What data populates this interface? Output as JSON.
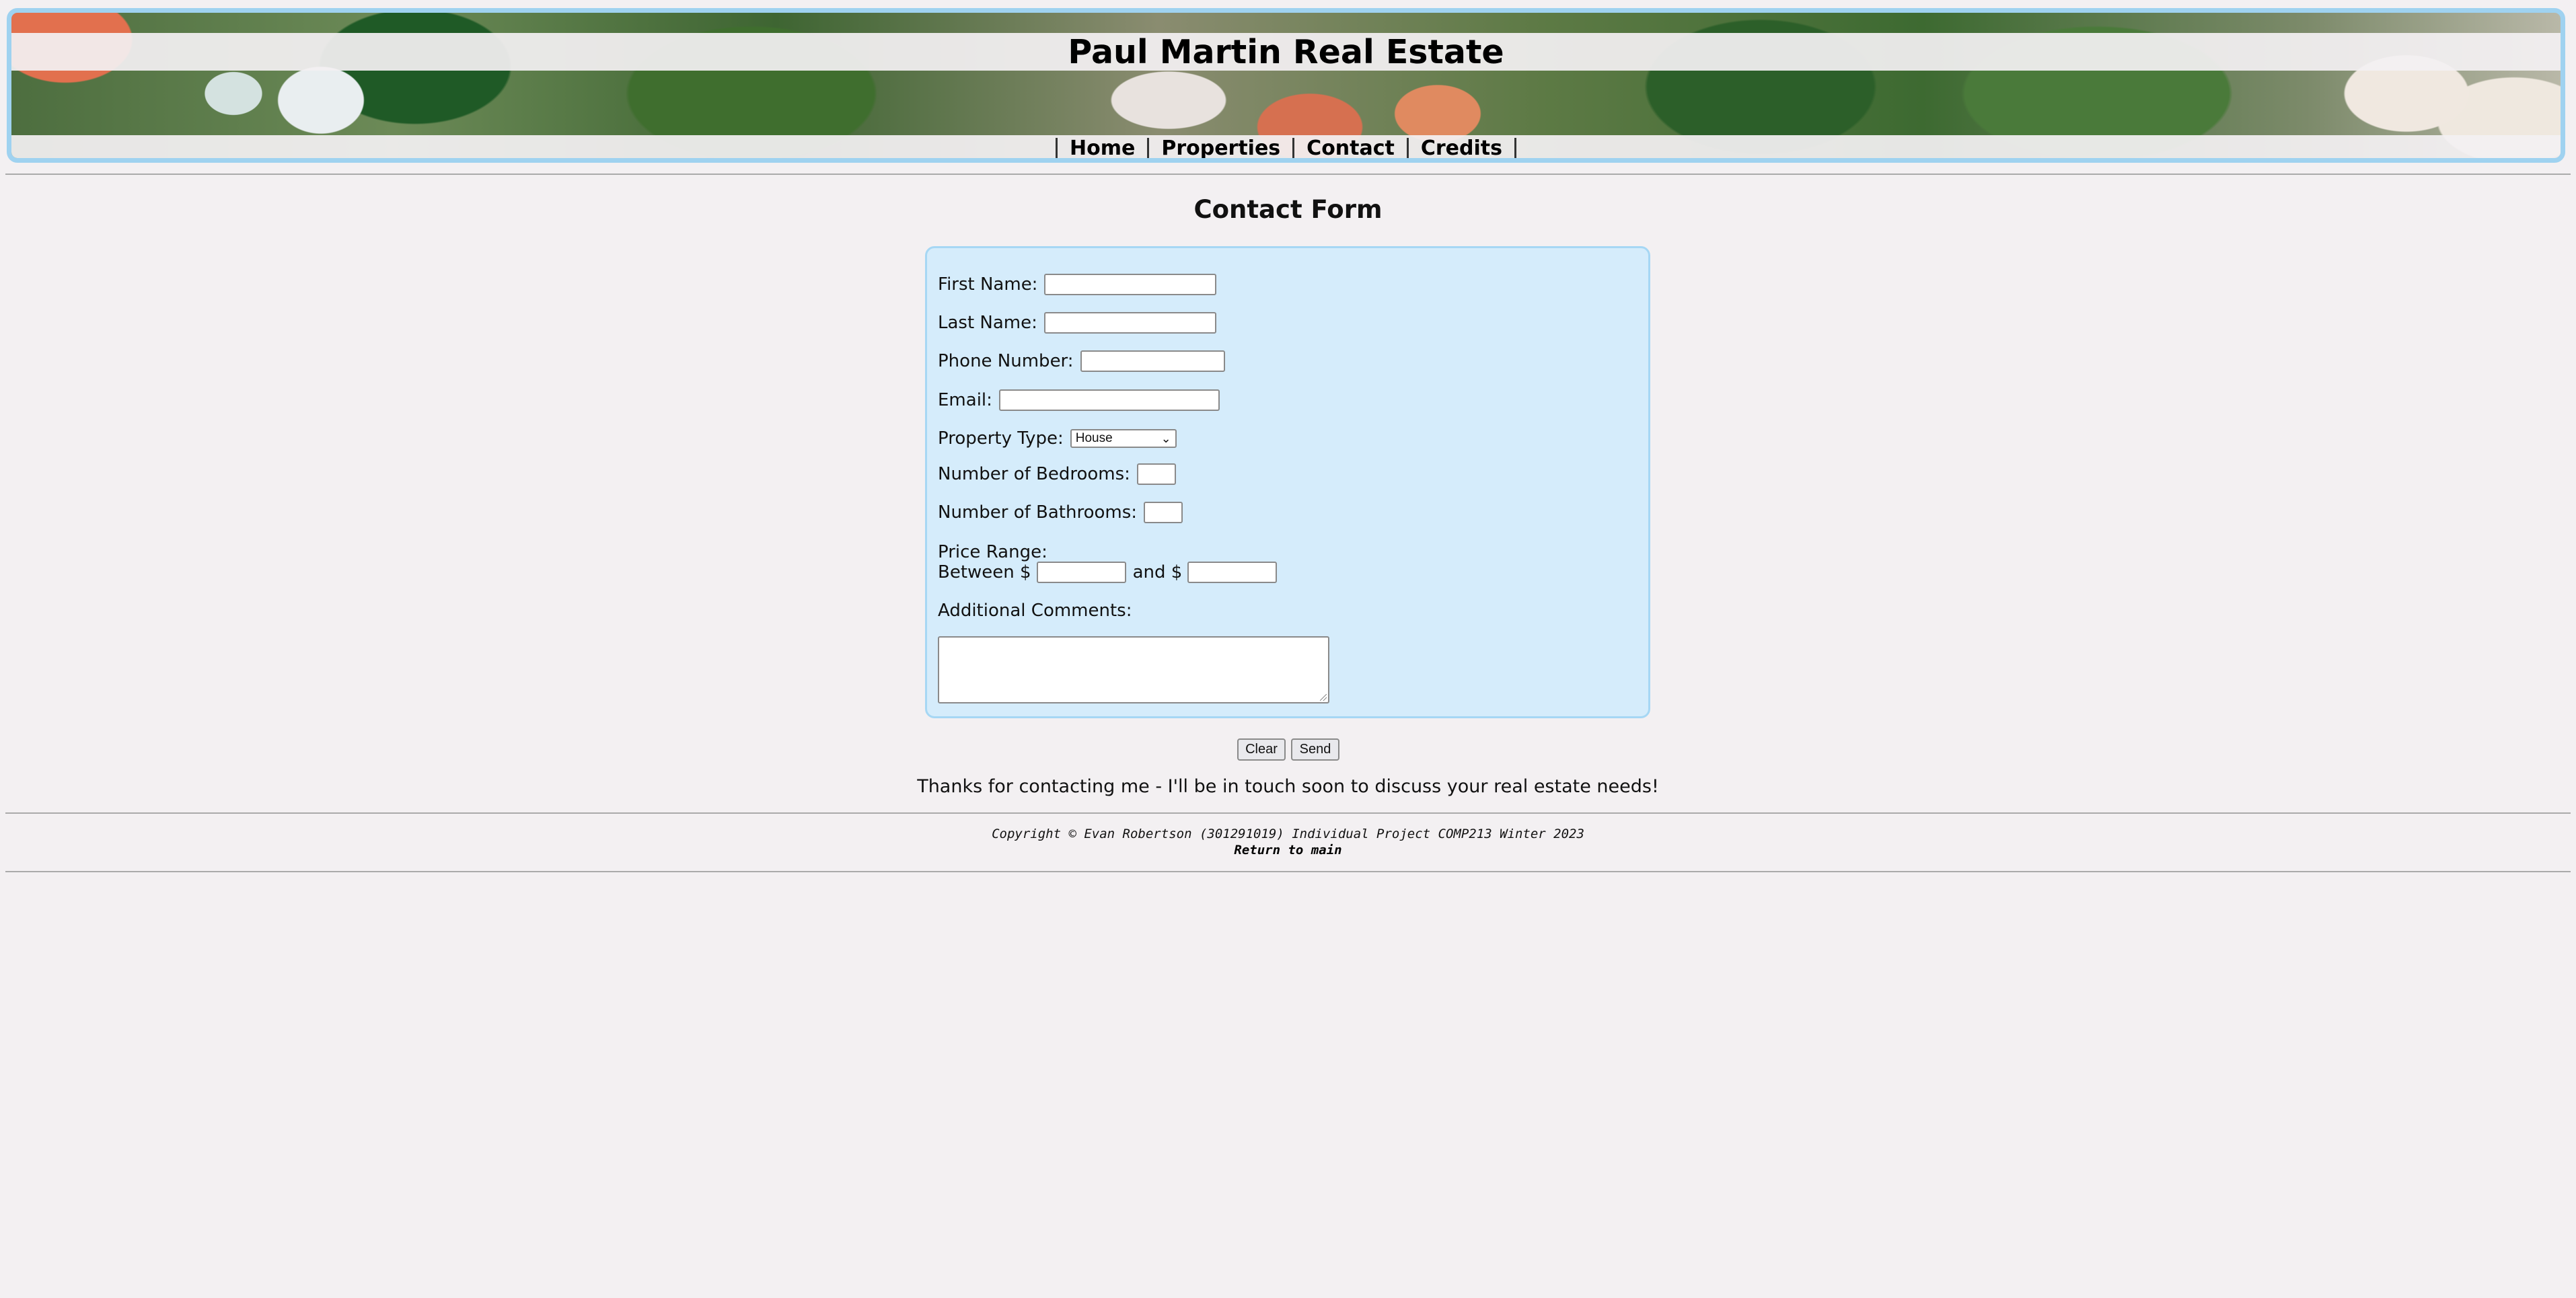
{
  "header": {
    "title": "Paul Martin Real Estate",
    "nav": [
      "Home",
      "Properties",
      "Contact",
      "Credits"
    ]
  },
  "form": {
    "heading": "Contact Form",
    "first_name_label": "First Name:",
    "last_name_label": "Last Name:",
    "phone_label": "Phone Number:",
    "email_label": "Email:",
    "property_type_label": "Property Type:",
    "property_type_selected": "House",
    "bedrooms_label": "Number of Bedrooms:",
    "bathrooms_label": "Number of Bathrooms:",
    "price_range_label": "Price Range:",
    "between_label": "Between $",
    "and_label": "and $",
    "comments_label": "Additional Comments:",
    "clear_label": "Clear",
    "send_label": "Send"
  },
  "thanks_message": "Thanks for contacting me - I'll be in touch soon to discuss your real estate needs!",
  "footer": {
    "copyright": "Copyright © Evan Robertson (301291019) Individual Project COMP213 Winter 2023",
    "return_link": "Return to main"
  },
  "colors": {
    "page_background": "#f3f0f2",
    "form_background": "#d5ecfb",
    "form_border": "#a6d7f4"
  }
}
